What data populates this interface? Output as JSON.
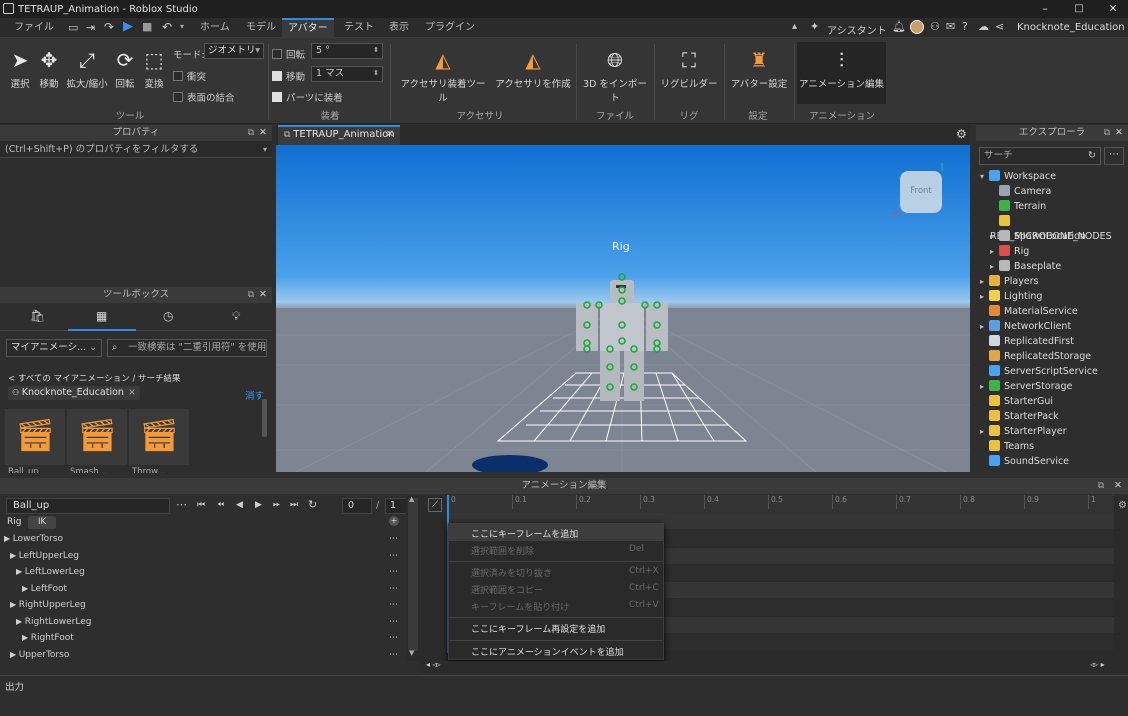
{
  "window": {
    "title": "TETRAUP_Animation - Roblox Studio",
    "min": "–",
    "max": "□",
    "close": "✕"
  },
  "menubar": {
    "file": "ファイル",
    "tabs": [
      "ホーム",
      "モデル",
      "アバター",
      "テスト",
      "表示",
      "プラグイン"
    ],
    "active_tab": "アバター",
    "assistant": "アシスタント",
    "user": "Knocknote_Education"
  },
  "ribbon": {
    "tools": {
      "select": "選択",
      "move": "移動",
      "scale": "拡大/縮小",
      "rotate": "回転",
      "transform": "変換",
      "group": "ツール"
    },
    "mode_label": "モード:",
    "mode_value": "ジオメトリ",
    "collision": "衝突",
    "join_surfaces": "表面の結合",
    "rotate_label": "回転",
    "rotate_value": "5 °",
    "move_label": "移動",
    "move_value": "1 マス",
    "parts_label": "パーツに装着",
    "group_equip": "装着",
    "accessory_tool": "アクセサリ装着ツール",
    "accessory_create": "アクセサリを作成",
    "group_accessory": "アクセサリ",
    "import_3d": "3D をインポート",
    "group_file": "ファイル",
    "rig_builder": "リグビルダー",
    "group_rig": "リグ",
    "avatar_settings": "アバター設定",
    "group_settings": "設定",
    "anim_editor": "アニメーション編集",
    "group_anim": "アニメーション"
  },
  "properties": {
    "title": "プロパティ",
    "filter": "(Ctrl+Shift+P) のプロパティをフィルタする"
  },
  "toolbox": {
    "title": "ツールボックス",
    "category": "マイアニメーシ...",
    "search_placeholder": "一致検索は \"二重引用符\" を使用",
    "breadcrumb": "< すべての マイアニメーション / サーチ結果",
    "chip": "Knocknote_Education",
    "clear": "消す",
    "items": [
      "Ball_up",
      "Smash...",
      "Throw..."
    ]
  },
  "viewport": {
    "tab": "TETRAUP_Animation",
    "rig_label": "Rig",
    "cube_label": "Front"
  },
  "explorer": {
    "title": "エクスプローラ",
    "search_placeholder": "サーチ",
    "items": [
      {
        "label": "Workspace",
        "depth": 0,
        "arrow": "▾",
        "color": "#4aa3f0"
      },
      {
        "label": "Camera",
        "depth": 1,
        "arrow": "",
        "color": "#9aa4ad"
      },
      {
        "label": "Terrain",
        "depth": 1,
        "arrow": "",
        "color": "#3fb24a"
      },
      {
        "label": "RBX_MICROBONE_NODES",
        "depth": 1,
        "arrow": "",
        "color": "#e9c145"
      },
      {
        "label": "SpawnLocation",
        "depth": 1,
        "arrow": "▸",
        "color": "#b8b8b8"
      },
      {
        "label": "Rig",
        "depth": 1,
        "arrow": "▸",
        "color": "#d94f4f"
      },
      {
        "label": "Baseplate",
        "depth": 1,
        "arrow": "▸",
        "color": "#b8b8b8"
      },
      {
        "label": "Players",
        "depth": 0,
        "arrow": "▸",
        "color": "#e2b23c"
      },
      {
        "label": "Lighting",
        "depth": 0,
        "arrow": "▸",
        "color": "#f0d24a"
      },
      {
        "label": "MaterialService",
        "depth": 0,
        "arrow": "",
        "color": "#e08a3a"
      },
      {
        "label": "NetworkClient",
        "depth": 0,
        "arrow": "▸",
        "color": "#5aa0e0"
      },
      {
        "label": "ReplicatedFirst",
        "depth": 0,
        "arrow": "",
        "color": "#cfd6de"
      },
      {
        "label": "ReplicatedStorage",
        "depth": 0,
        "arrow": "",
        "color": "#e0a64a"
      },
      {
        "label": "ServerScriptService",
        "depth": 0,
        "arrow": "",
        "color": "#4aa3f0"
      },
      {
        "label": "ServerStorage",
        "depth": 0,
        "arrow": "▸",
        "color": "#3fb24a"
      },
      {
        "label": "StarterGui",
        "depth": 0,
        "arrow": "",
        "color": "#e9c145"
      },
      {
        "label": "StarterPack",
        "depth": 0,
        "arrow": "",
        "color": "#e9c145"
      },
      {
        "label": "StarterPlayer",
        "depth": 0,
        "arrow": "▸",
        "color": "#e9c145"
      },
      {
        "label": "Teams",
        "depth": 0,
        "arrow": "",
        "color": "#e9c145"
      },
      {
        "label": "SoundService",
        "depth": 0,
        "arrow": "",
        "color": "#4aa3f0"
      }
    ]
  },
  "anim_editor": {
    "title": "アニメーション編集",
    "anim_name": "Ball_up",
    "frame_current": "0",
    "frame_sep": "/",
    "frame_total": "1",
    "rig_label": "Rig",
    "ik_label": "IK",
    "ruler": [
      "0",
      "0.1",
      "0.2",
      "0.3",
      "0.4",
      "0.5",
      "0.6",
      "0.7",
      "0.8",
      "0.9",
      "1"
    ],
    "tracks": [
      {
        "label": "LowerTorso",
        "depth": 0
      },
      {
        "label": "LeftUpperLeg",
        "depth": 1
      },
      {
        "label": "LeftLowerLeg",
        "depth": 2
      },
      {
        "label": "LeftFoot",
        "depth": 3
      },
      {
        "label": "RightUpperLeg",
        "depth": 1
      },
      {
        "label": "RightLowerLeg",
        "depth": 2
      },
      {
        "label": "RightFoot",
        "depth": 3
      },
      {
        "label": "UpperTorso",
        "depth": 1
      }
    ],
    "context_menu": [
      {
        "label": "ここにキーフレームを追加",
        "shortcut": "",
        "enabled": true,
        "highlight": true
      },
      {
        "label": "選択範囲を削除",
        "shortcut": "Del",
        "enabled": false
      },
      {
        "label": "選択済みを切り抜き",
        "shortcut": "Ctrl+X",
        "enabled": false
      },
      {
        "label": "選択範囲をコピー",
        "shortcut": "Ctrl+C",
        "enabled": false
      },
      {
        "label": "キーフレームを貼り付け",
        "shortcut": "Ctrl+V",
        "enabled": false
      },
      {
        "label": "ここにキーフレーム再設定を追加",
        "shortcut": "",
        "enabled": true
      },
      {
        "label": "ここにアニメーションイベントを追加",
        "shortcut": "",
        "enabled": true
      }
    ]
  },
  "output": {
    "label": "出力"
  }
}
